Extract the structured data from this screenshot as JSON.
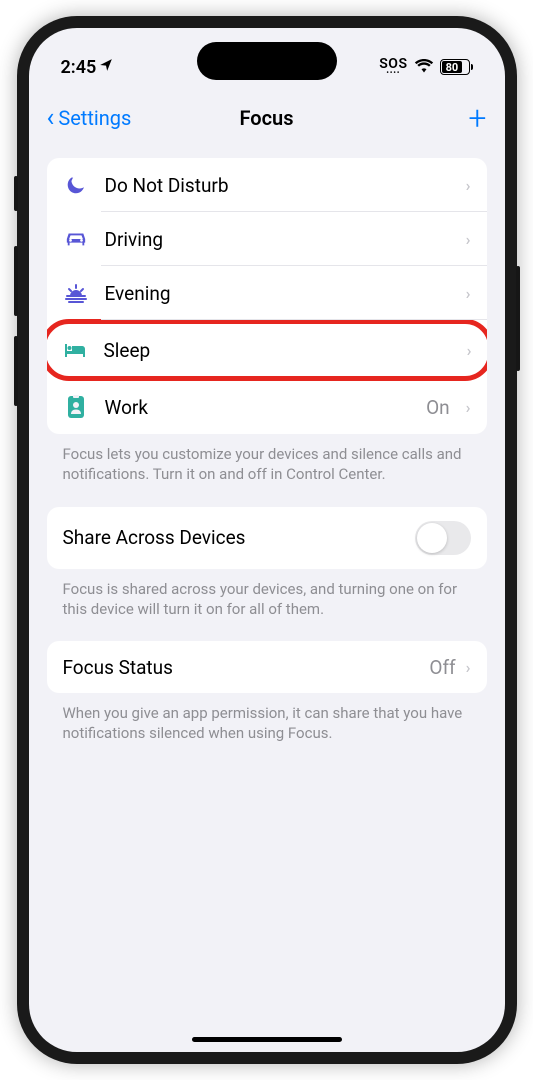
{
  "status": {
    "time": "2:45",
    "sos": "SOS",
    "battery": "80"
  },
  "nav": {
    "back": "Settings",
    "title": "Focus"
  },
  "focus_modes": [
    {
      "icon": "moon",
      "label": "Do Not Disturb",
      "value": "",
      "color": "purple"
    },
    {
      "icon": "car",
      "label": "Driving",
      "value": "",
      "color": "purple"
    },
    {
      "icon": "sunset",
      "label": "Evening",
      "value": "",
      "color": "purple"
    },
    {
      "icon": "bed",
      "label": "Sleep",
      "value": "",
      "color": "teal",
      "highlighted": true
    },
    {
      "icon": "badge",
      "label": "Work",
      "value": "On",
      "color": "teal"
    }
  ],
  "footers": {
    "focus_desc": "Focus lets you customize your devices and silence calls and notifications. Turn it on and off in Control Center.",
    "share_desc": "Focus is shared across your devices, and turning one on for this device will turn it on for all of them.",
    "status_desc": "When you give an app permission, it can share that you have notifications silenced when using Focus."
  },
  "share": {
    "label": "Share Across Devices",
    "on": false
  },
  "focus_status": {
    "label": "Focus Status",
    "value": "Off"
  }
}
